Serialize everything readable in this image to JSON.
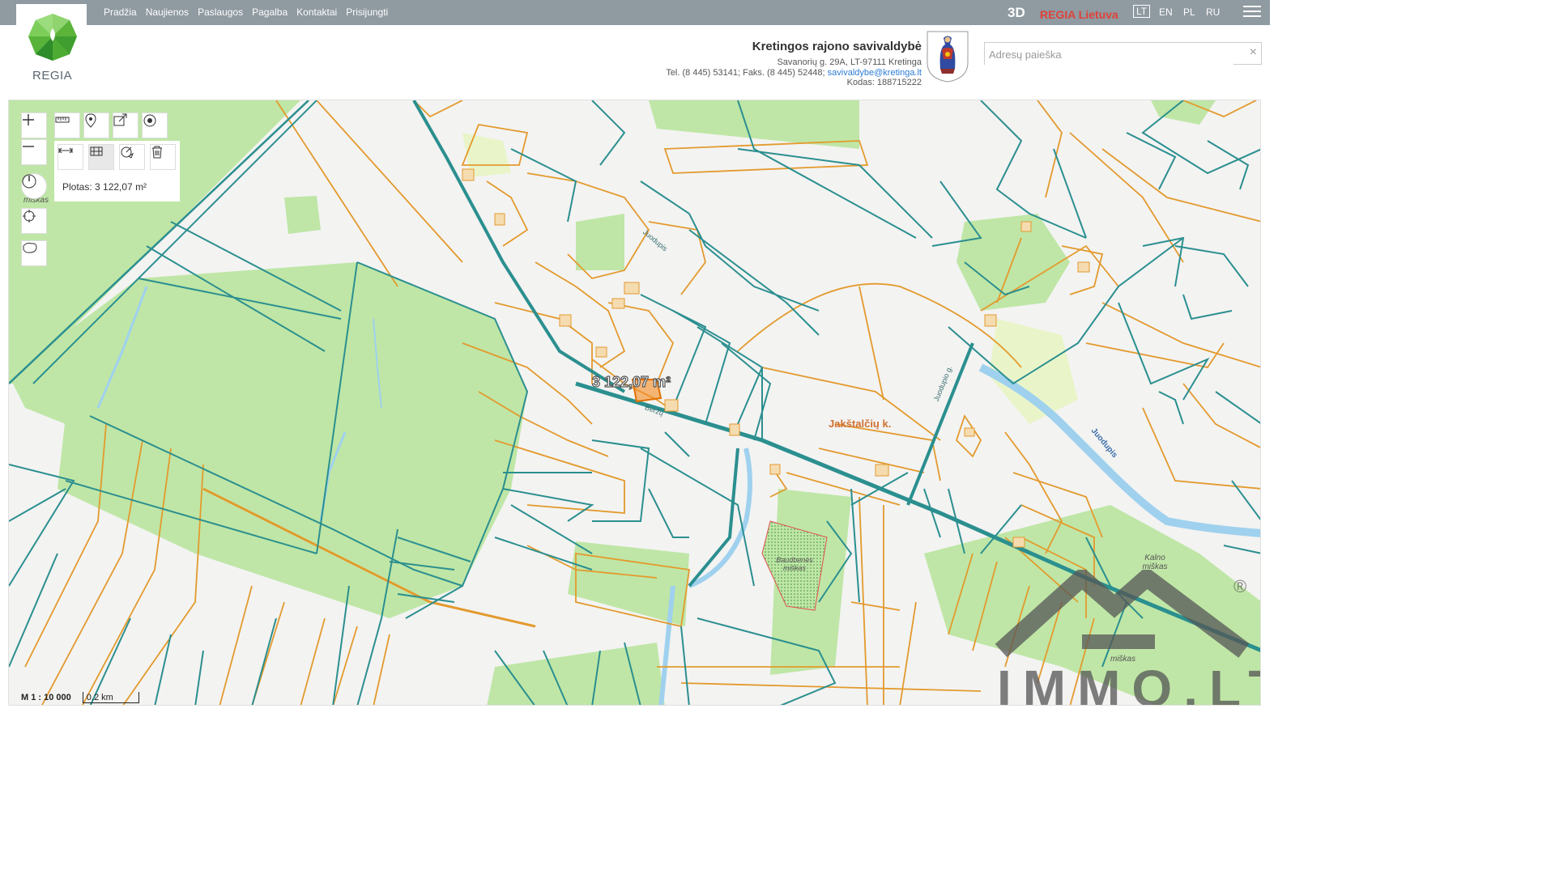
{
  "nav": {
    "items": [
      "Pradžia",
      "Naujienos",
      "Paslaugos",
      "Pagalba",
      "Kontaktai",
      "Prisijungti"
    ]
  },
  "logo": {
    "text": "REGIA"
  },
  "header": {
    "btn_3d": "3D",
    "regia_lt": "REGIA Lietuva",
    "languages": [
      "LT",
      "EN",
      "PL",
      "RU"
    ],
    "active_language": "LT"
  },
  "municipality": {
    "name": "Kretingos rajono savivaldybė",
    "address": "Savanorių g. 29A, LT-97111 Kretinga",
    "phone": "Tel. (8 445) 53141; Faks. (8 445) 52448; ",
    "email": "savivaldybe@kretinga.lt",
    "code": "Kodas: 188715222"
  },
  "search": {
    "placeholder": "Adresų paieška",
    "clear": "×"
  },
  "measure": {
    "area_panel": "Plotas: 3 122,07 m²",
    "area_on_map": "3 122,07 m²"
  },
  "map_labels": {
    "village": "Jakštalčių k.",
    "river": "Juodupis",
    "road1": "Juodupis",
    "road2": "Beržų",
    "road3": "Juodupio g.",
    "forest1_a": "Baudbenės",
    "forest1_b": "miškas",
    "forest2_a": "Kalno",
    "forest2_b": "miškas",
    "forest3": "miškas",
    "forest4": "miškas"
  },
  "scale": {
    "ratio": "M 1 : 10 000",
    "bar": "0.2 km"
  },
  "watermark": {
    "text": "IMMO.LT",
    "registered": "®"
  },
  "colors": {
    "topbar": "#8f9aa1",
    "parcel_teal": "#2b8f8f",
    "parcel_orange": "#e39a2d",
    "forest": "#bfe6a6",
    "water": "#9fd1ee",
    "accent_red": "#e0423a"
  }
}
